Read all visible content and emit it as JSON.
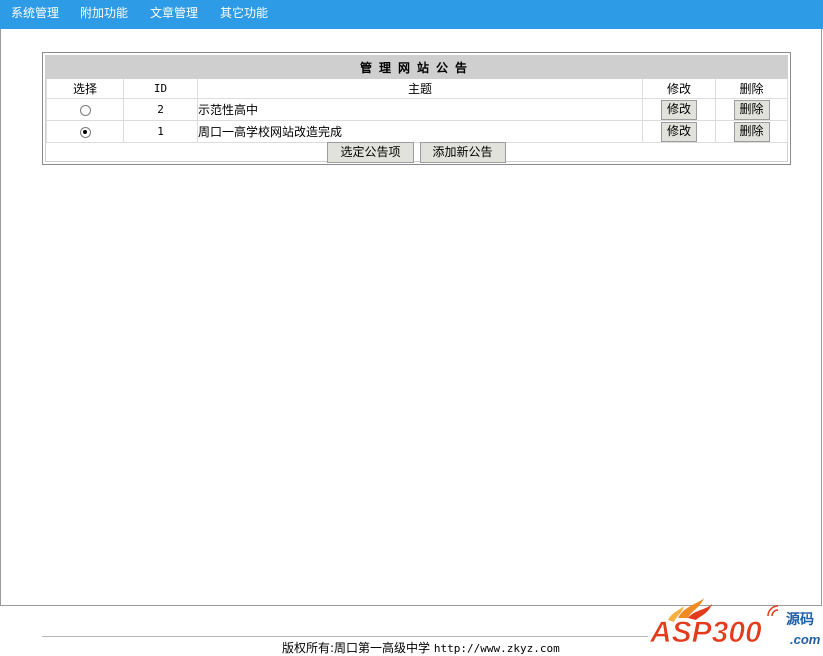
{
  "nav": {
    "items": [
      {
        "label": "系统管理"
      },
      {
        "label": "附加功能"
      },
      {
        "label": "文章管理"
      },
      {
        "label": "其它功能"
      }
    ]
  },
  "panel": {
    "title": "管理网站公告",
    "columns": {
      "select": "选择",
      "id": "ID",
      "subject": "主题",
      "edit": "修改",
      "delete": "删除"
    },
    "rows": [
      {
        "id": "2",
        "subject": "示范性高中",
        "selected": false,
        "edit_label": "修改",
        "delete_label": "删除"
      },
      {
        "id": "1",
        "subject": "周口一高学校网站改造完成",
        "selected": true,
        "edit_label": "修改",
        "delete_label": "删除"
      }
    ],
    "actions": {
      "select_button": "选定公告项",
      "add_button": "添加新公告"
    }
  },
  "footer": {
    "copyright": "版权所有:周口第一高级中学",
    "url": "http://www.zkyz.com"
  },
  "watermark": {
    "brand": "ASP300",
    "suffix": ".com",
    "tag": "源码",
    "colors": {
      "primary": "#e33b1c",
      "accent": "#1f5fa8",
      "flame": "#f08a24"
    }
  }
}
